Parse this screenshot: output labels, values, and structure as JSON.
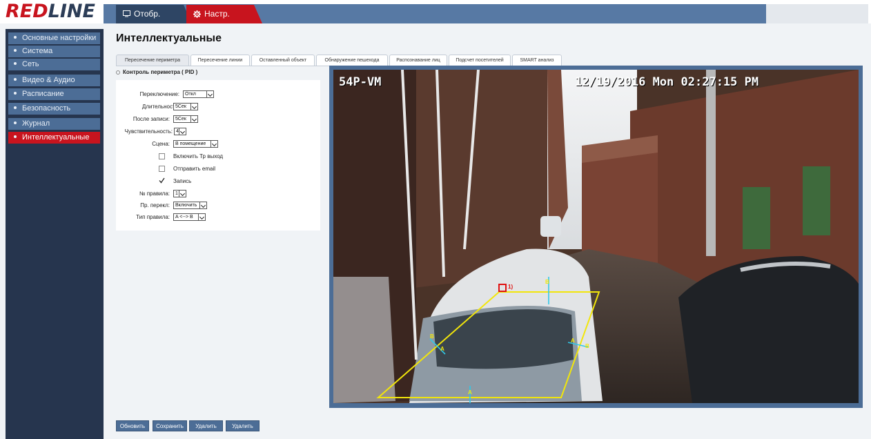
{
  "logo": {
    "part1": "RED",
    "part2": "LINE"
  },
  "top_tabs": [
    {
      "label": "Отобр.",
      "icon": "monitor-icon"
    },
    {
      "label": "Настр.",
      "icon": "gear-icon"
    }
  ],
  "sidebar": {
    "items": [
      {
        "label": "Основные настройки"
      },
      {
        "label": "Система"
      },
      {
        "label": "Сеть"
      },
      {
        "label": "Видео & Аудио"
      },
      {
        "label": "Расписание"
      },
      {
        "label": "Безопасность"
      },
      {
        "label": "Журнал"
      },
      {
        "label": "Интеллектуальные",
        "active": true
      }
    ]
  },
  "page_title": "Интеллектуальные",
  "sub_tabs": [
    "Пересечение периметра",
    "Пересечение линии",
    "Оставленный объект",
    "Обнаружение пешехода",
    "Распознавание лиц",
    "Подсчет посетителей",
    "SMART анализ"
  ],
  "section_title": "Контроль периметра",
  "section_code": "( PID )",
  "form": {
    "switch_label": "Переключение:",
    "switch_value": "Откл",
    "duration_label": "Длительность:",
    "duration_value": "5Сек",
    "post_record_label": "После записи:",
    "post_record_value": "5Сек",
    "sensitivity_label": "Чувствительность:",
    "sensitivity_value": "4",
    "scene_label": "Сцена:",
    "scene_value": "В помещение",
    "enable_output_label": "Включить Тр выход",
    "enable_output_checked": false,
    "send_email_label": "Отправить email",
    "send_email_checked": false,
    "record_label": "Запись",
    "record_checked": true,
    "rule_no_label": "№ правила:",
    "rule_no_value": "1",
    "rule_switch_label": "Пр. перекл:",
    "rule_switch_value": "Включить",
    "rule_type_label": "Тип правила:",
    "rule_type_value": "A <--> B"
  },
  "video": {
    "camera_name": "54P-VM",
    "timestamp": "12/19/2016 Mon 02:27:15 PM",
    "zone_label": "1)",
    "marker_a": "A",
    "marker_b": "B"
  },
  "buttons": {
    "refresh": "Обновить",
    "save": "Сохранить",
    "delete1": "Удалить",
    "delete2": "Удалить"
  },
  "colors": {
    "brand_red": "#c8141e",
    "nav_blue": "#4c6d96",
    "sidebar_bg": "#26354e",
    "zone_yellow": "#f2e60a",
    "marker_cyan": "#30c8e8"
  }
}
